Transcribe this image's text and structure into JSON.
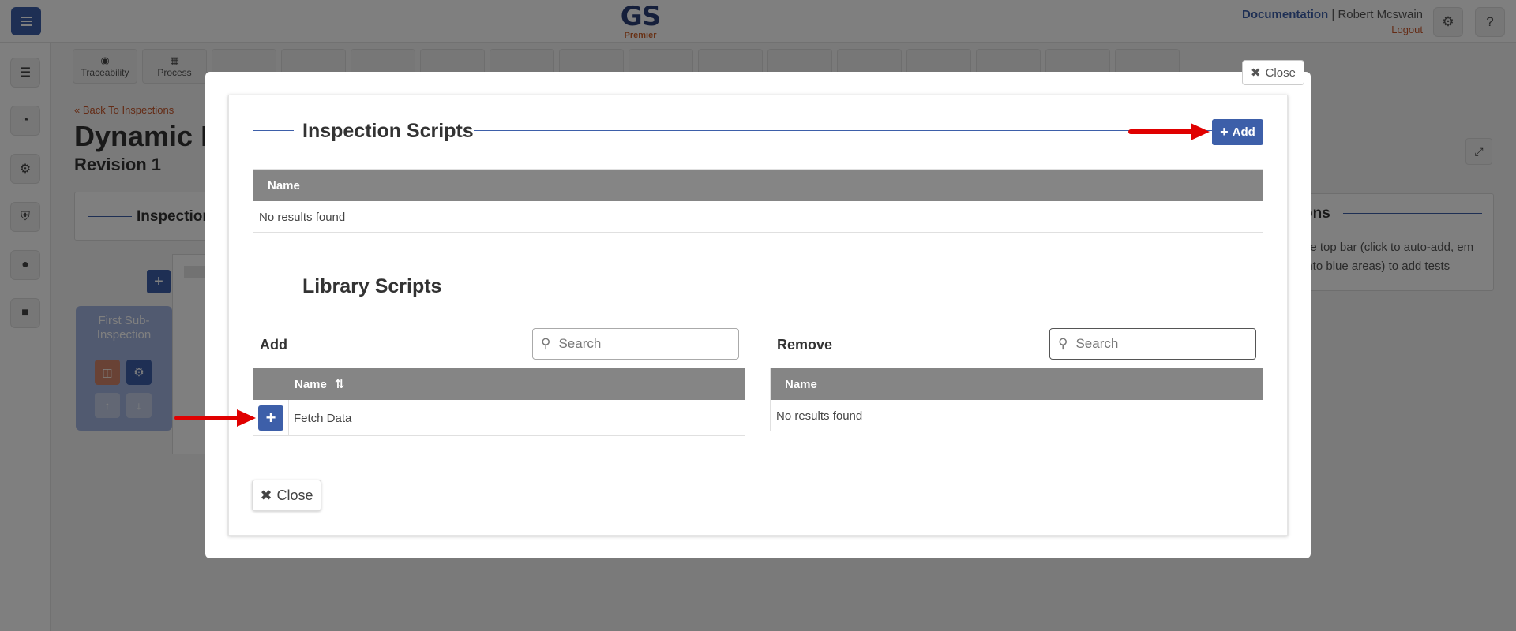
{
  "topbar": {
    "logo_main": "GS",
    "logo_sub": "Premier",
    "documentation": "Documentation",
    "separator": "|",
    "user": "Robert Mcswain",
    "logout": "Logout"
  },
  "toolbar": {
    "items": [
      {
        "label": "Traceability",
        "icon": "tag-icon"
      },
      {
        "label": "Process",
        "icon": "process-icon"
      }
    ]
  },
  "page": {
    "back": "Back To Inspections",
    "title": "Dynamic I",
    "revision": "Revision 1",
    "left_card_title": "Inspection",
    "sub_inspection": "First Sub-Inspection",
    "right_card_title": "ons",
    "right_card_text": "he top bar (click to auto-add, em into blue areas) to add tests"
  },
  "modal": {
    "close_top": "Close",
    "inspection_scripts": {
      "title": "Inspection Scripts",
      "add_label": "Add",
      "column": "Name",
      "empty": "No results found"
    },
    "library_scripts": {
      "title": "Library Scripts",
      "add_panel": {
        "label": "Add",
        "search_placeholder": "Search",
        "column": "Name",
        "rows": [
          {
            "name": "Fetch Data"
          }
        ]
      },
      "remove_panel": {
        "label": "Remove",
        "search_placeholder": "Search",
        "column": "Name",
        "empty": "No results found"
      }
    },
    "close_bottom": "Close"
  },
  "colors": {
    "accent": "#3d5fa9",
    "brand_orange": "#c8562a",
    "table_header": "#858585",
    "annotation_arrow": "#e00000"
  }
}
